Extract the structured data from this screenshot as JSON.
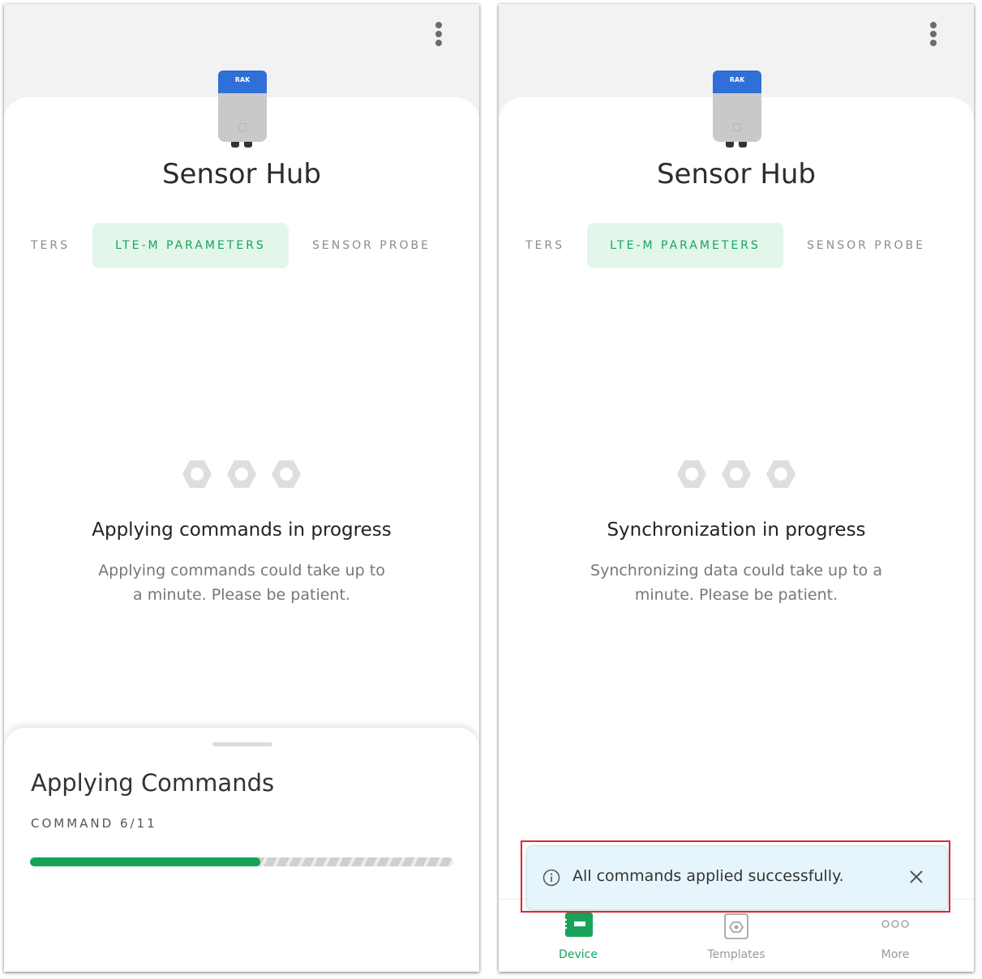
{
  "left_screen": {
    "device_brand": "RAK",
    "title": "Sensor Hub",
    "tabs": [
      "TERS",
      "LTE-M PARAMETERS",
      "SENSOR PROBE"
    ],
    "status": {
      "title": "Applying commands in progress",
      "description": "Applying commands could take up to a minute. Please be patient."
    },
    "sheet": {
      "title": "Applying Commands",
      "subtitle": "COMMAND 6/11",
      "progress": 0.545
    }
  },
  "right_screen": {
    "device_brand": "RAK",
    "title": "Sensor Hub",
    "tabs": [
      "TERS",
      "LTE-M PARAMETERS",
      "SENSOR PROBE"
    ],
    "status": {
      "title": "Synchronization in progress",
      "description": "Synchronizing data could take up to a minute. Please be patient."
    },
    "toast": {
      "message": "All commands applied successfully.",
      "icon": "info-icon"
    },
    "nav": [
      {
        "label": "Device",
        "icon": "device-icon",
        "active": true
      },
      {
        "label": "Templates",
        "icon": "templates-icon",
        "active": false
      },
      {
        "label": "More",
        "icon": "more-dots-icon",
        "active": false
      }
    ]
  },
  "colors": {
    "accent": "#18a35b",
    "tab_active_bg": "#e3f6ea",
    "progress": "#13a457",
    "toast_bg": "#e6f5fb",
    "highlight": "#e0262f",
    "device_cap": "#2f6fd6"
  }
}
